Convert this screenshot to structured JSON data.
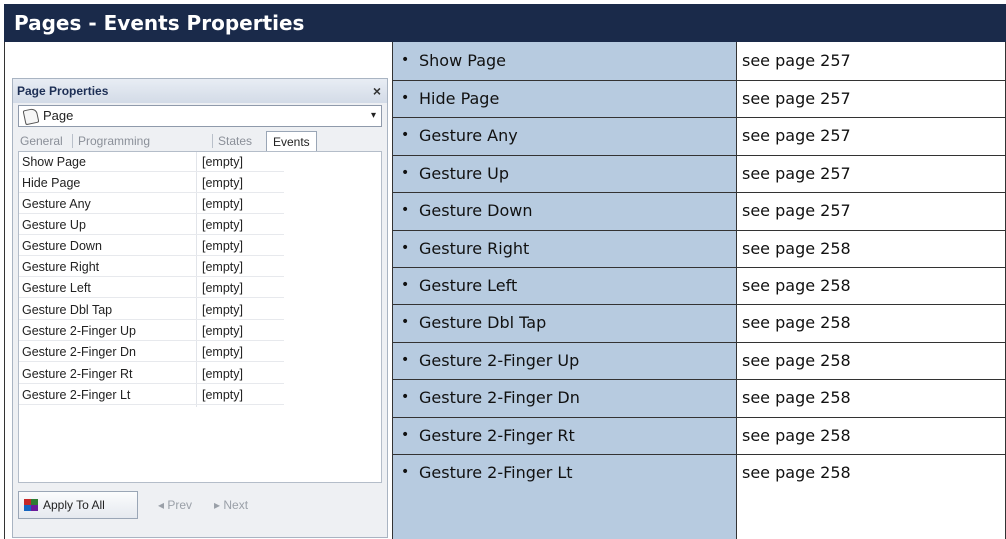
{
  "header": {
    "title": "Pages - Events Properties"
  },
  "panel": {
    "title": "Page Properties",
    "close_glyph": "×",
    "selector": {
      "value": "Page",
      "icon": "page-icon",
      "arrow": "▾"
    },
    "tabs": [
      {
        "label": "General",
        "active": false
      },
      {
        "label": "Programming",
        "active": false
      },
      {
        "label": "States",
        "active": false
      },
      {
        "label": "Events",
        "active": true
      }
    ],
    "properties": [
      {
        "name": "Show Page",
        "value": "[empty]"
      },
      {
        "name": "Hide Page",
        "value": "[empty]"
      },
      {
        "name": "Gesture Any",
        "value": "[empty]"
      },
      {
        "name": "Gesture Up",
        "value": "[empty]"
      },
      {
        "name": "Gesture Down",
        "value": "[empty]"
      },
      {
        "name": "Gesture Right",
        "value": "[empty]"
      },
      {
        "name": "Gesture Left",
        "value": "[empty]"
      },
      {
        "name": "Gesture Dbl Tap",
        "value": "[empty]"
      },
      {
        "name": "Gesture 2-Finger Up",
        "value": "[empty]"
      },
      {
        "name": "Gesture 2-Finger Dn",
        "value": "[empty]"
      },
      {
        "name": "Gesture 2-Finger Rt",
        "value": "[empty]"
      },
      {
        "name": "Gesture 2-Finger Lt",
        "value": "[empty]"
      }
    ],
    "footer": {
      "apply_label": "Apply To All",
      "prev_label": "◂ Prev",
      "next_label": "▸ Next"
    }
  },
  "events_table": {
    "bullet": "•",
    "rows": [
      {
        "event": "Show Page",
        "reference": "see page 257"
      },
      {
        "event": "Hide Page",
        "reference": "see page 257"
      },
      {
        "event": "Gesture Any",
        "reference": "see page 257"
      },
      {
        "event": "Gesture Up",
        "reference": "see page 257"
      },
      {
        "event": "Gesture Down",
        "reference": "see page 257"
      },
      {
        "event": "Gesture Right",
        "reference": "see page 258"
      },
      {
        "event": "Gesture Left",
        "reference": "see page 258"
      },
      {
        "event": "Gesture Dbl Tap",
        "reference": "see page 258"
      },
      {
        "event": "Gesture 2-Finger Up",
        "reference": "see page 258"
      },
      {
        "event": "Gesture 2-Finger Dn",
        "reference": "see page 258"
      },
      {
        "event": "Gesture 2-Finger Rt",
        "reference": "see page 258"
      },
      {
        "event": "Gesture 2-Finger Lt",
        "reference": "see page 258"
      }
    ]
  },
  "colors": {
    "header_bg": "#1a2a4a",
    "event_column_bg": "#b7cbe0"
  }
}
